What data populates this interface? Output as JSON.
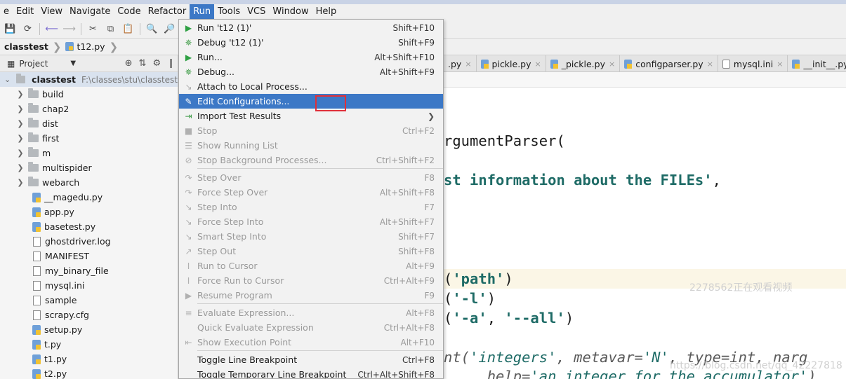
{
  "menubar": {
    "items": [
      {
        "label": "e",
        "active": false
      },
      {
        "label": "Edit",
        "active": false
      },
      {
        "label": "View",
        "active": false
      },
      {
        "label": "Navigate",
        "active": false
      },
      {
        "label": "Code",
        "active": false
      },
      {
        "label": "Refactor",
        "active": false
      },
      {
        "label": "Run",
        "active": true
      },
      {
        "label": "Tools",
        "active": false
      },
      {
        "label": "VCS",
        "active": false
      },
      {
        "label": "Window",
        "active": false
      },
      {
        "label": "Help",
        "active": false
      }
    ]
  },
  "navbar": {
    "project": "classtest",
    "file": "t12.py"
  },
  "sidebar": {
    "header": "Project",
    "root_name": "classtest",
    "root_path": "F:\\classes\\stu\\classtest",
    "items": [
      {
        "label": "build",
        "kind": "folder"
      },
      {
        "label": "chap2",
        "kind": "folder"
      },
      {
        "label": "dist",
        "kind": "folder"
      },
      {
        "label": "first",
        "kind": "folder"
      },
      {
        "label": "m",
        "kind": "folder"
      },
      {
        "label": "multispider",
        "kind": "folder"
      },
      {
        "label": "webarch",
        "kind": "folder"
      },
      {
        "label": "__magedu.py",
        "kind": "py"
      },
      {
        "label": "app.py",
        "kind": "py"
      },
      {
        "label": "basetest.py",
        "kind": "py"
      },
      {
        "label": "ghostdriver.log",
        "kind": "txt"
      },
      {
        "label": "MANIFEST",
        "kind": "txt"
      },
      {
        "label": "my_binary_file",
        "kind": "txt"
      },
      {
        "label": "mysql.ini",
        "kind": "txt"
      },
      {
        "label": "sample",
        "kind": "txt"
      },
      {
        "label": "scrapy.cfg",
        "kind": "txt"
      },
      {
        "label": "setup.py",
        "kind": "py"
      },
      {
        "label": "t.py",
        "kind": "py"
      },
      {
        "label": "t1.py",
        "kind": "py"
      },
      {
        "label": "t2.py",
        "kind": "py"
      }
    ]
  },
  "tabs": [
    {
      "label": ".py",
      "icon": "py"
    },
    {
      "label": "pickle.py",
      "icon": "py"
    },
    {
      "label": "_pickle.py",
      "icon": "py"
    },
    {
      "label": "configparser.py",
      "icon": "py"
    },
    {
      "label": "mysql.ini",
      "icon": "ini"
    },
    {
      "label": "__init__.py",
      "icon": "py"
    }
  ],
  "run_menu": {
    "items": [
      {
        "type": "item",
        "label": "Run 't12 (1)'",
        "shortcut": "Shift+F10",
        "icon": "play-icon",
        "disabled": false
      },
      {
        "type": "item",
        "label": "Debug 't12 (1)'",
        "shortcut": "Shift+F9",
        "icon": "bug-icon",
        "disabled": false
      },
      {
        "type": "item",
        "label": "Run...",
        "shortcut": "Alt+Shift+F10",
        "icon": "play-icon",
        "disabled": false
      },
      {
        "type": "item",
        "label": "Debug...",
        "shortcut": "Alt+Shift+F9",
        "icon": "bug-icon",
        "disabled": false
      },
      {
        "type": "item",
        "label": "Attach to Local Process...",
        "shortcut": "",
        "icon": "attach-icon",
        "disabled": false
      },
      {
        "type": "item",
        "label": "Edit Configurations...",
        "shortcut": "",
        "icon": "edit-config-icon",
        "disabled": false,
        "selected": true
      },
      {
        "type": "item",
        "label": "Import Test Results",
        "shortcut": "",
        "icon": "import-icon",
        "disabled": false,
        "submenu": true
      },
      {
        "type": "item",
        "label": "Stop",
        "shortcut": "Ctrl+F2",
        "icon": "stop-icon",
        "disabled": true
      },
      {
        "type": "item",
        "label": "Show Running List",
        "shortcut": "",
        "icon": "list-icon",
        "disabled": true
      },
      {
        "type": "item",
        "label": "Stop Background Processes...",
        "shortcut": "Ctrl+Shift+F2",
        "icon": "stop-bg-icon",
        "disabled": true
      },
      {
        "type": "sep"
      },
      {
        "type": "item",
        "label": "Step Over",
        "shortcut": "F8",
        "icon": "step-over-icon",
        "disabled": true
      },
      {
        "type": "item",
        "label": "Force Step Over",
        "shortcut": "Alt+Shift+F8",
        "icon": "force-step-over-icon",
        "disabled": true
      },
      {
        "type": "item",
        "label": "Step Into",
        "shortcut": "F7",
        "icon": "step-into-icon",
        "disabled": true
      },
      {
        "type": "item",
        "label": "Force Step Into",
        "shortcut": "Alt+Shift+F7",
        "icon": "force-step-into-icon",
        "disabled": true
      },
      {
        "type": "item",
        "label": "Smart Step Into",
        "shortcut": "Shift+F7",
        "icon": "smart-step-into-icon",
        "disabled": true
      },
      {
        "type": "item",
        "label": "Step Out",
        "shortcut": "Shift+F8",
        "icon": "step-out-icon",
        "disabled": true
      },
      {
        "type": "item",
        "label": "Run to Cursor",
        "shortcut": "Alt+F9",
        "icon": "run-to-cursor-icon",
        "disabled": true
      },
      {
        "type": "item",
        "label": "Force Run to Cursor",
        "shortcut": "Ctrl+Alt+F9",
        "icon": "force-run-to-cursor-icon",
        "disabled": true
      },
      {
        "type": "item",
        "label": "Resume Program",
        "shortcut": "F9",
        "icon": "resume-icon",
        "disabled": true
      },
      {
        "type": "sep"
      },
      {
        "type": "item",
        "label": "Evaluate Expression...",
        "shortcut": "Alt+F8",
        "icon": "evaluate-icon",
        "disabled": true
      },
      {
        "type": "item",
        "label": "Quick Evaluate Expression",
        "shortcut": "Ctrl+Alt+F8",
        "icon": "",
        "disabled": true
      },
      {
        "type": "item",
        "label": "Show Execution Point",
        "shortcut": "Alt+F10",
        "icon": "exec-point-icon",
        "disabled": true
      },
      {
        "type": "sep"
      },
      {
        "type": "item",
        "label": "Toggle Line Breakpoint",
        "shortcut": "Ctrl+F8",
        "icon": "",
        "disabled": false
      },
      {
        "type": "item",
        "label": "Toggle Temporary Line Breakpoint",
        "shortcut": "Ctrl+Alt+Shift+F8",
        "icon": "",
        "disabled": false
      }
    ]
  },
  "code": {
    "line1": "rgumentParser(",
    "line2a": "st information about the FILEs'",
    "line2b": ",",
    "line3a": "(",
    "line3b": "'path'",
    "line3c": ")",
    "line4a": "(",
    "line4b": "'-l'",
    "line4c": ")",
    "line5a": "(",
    "line5b": "'-a'",
    "line5c": ", ",
    "line5d": "'--all'",
    "line5e": ")",
    "line6a": "nt(",
    "line6b": "'integers'",
    "line6c": ", metavar=",
    "line6d": "'N'",
    "line6e": ", type=int, narg",
    "line7a": "     help=",
    "line7b": "'an integer for the accumulator'",
    "line7c": ")"
  },
  "watermarks": {
    "viewer": "2278562正在观看视频",
    "url": "https://blog.csdn.net/qq_42227818"
  }
}
